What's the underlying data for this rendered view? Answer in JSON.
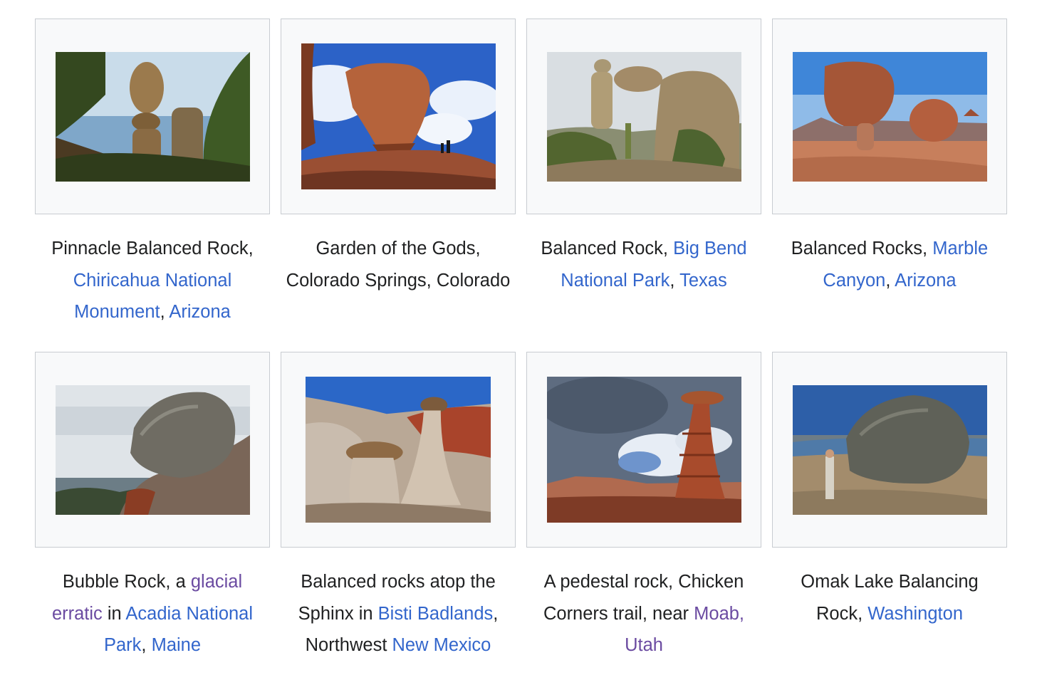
{
  "gallery": {
    "items": [
      {
        "name": "pinnacle-balanced-rock",
        "image": "photo-pinnacle-balanced-rock",
        "caption": [
          {
            "text": "Pinnacle Balanced Rock, ",
            "link": false
          },
          {
            "text": "Chiricahua National Monument",
            "link": true,
            "visited": false
          },
          {
            "text": ", ",
            "link": false
          },
          {
            "text": "Arizona",
            "link": true,
            "visited": false
          }
        ]
      },
      {
        "name": "garden-of-the-gods",
        "image": "photo-garden-of-the-gods",
        "caption": [
          {
            "text": "Garden of the Gods, Colorado Springs, Colorado",
            "link": false
          }
        ]
      },
      {
        "name": "balanced-rock-big-bend",
        "image": "photo-balanced-rock-big-bend",
        "caption": [
          {
            "text": "Balanced Rock, ",
            "link": false
          },
          {
            "text": "Big Bend National Park",
            "link": true,
            "visited": false
          },
          {
            "text": ", ",
            "link": false
          },
          {
            "text": "Texas",
            "link": true,
            "visited": false
          }
        ]
      },
      {
        "name": "balanced-rocks-marble-canyon",
        "image": "photo-balanced-rocks-marble-canyon",
        "caption": [
          {
            "text": "Balanced Rocks, ",
            "link": false
          },
          {
            "text": "Marble Canyon",
            "link": true,
            "visited": false
          },
          {
            "text": ", ",
            "link": false
          },
          {
            "text": "Arizona",
            "link": true,
            "visited": false
          }
        ]
      },
      {
        "name": "bubble-rock",
        "image": "photo-bubble-rock",
        "caption": [
          {
            "text": "Bubble Rock, a ",
            "link": false
          },
          {
            "text": "glacial erratic",
            "link": true,
            "visited": true
          },
          {
            "text": " in ",
            "link": false
          },
          {
            "text": "Acadia National Park",
            "link": true,
            "visited": false
          },
          {
            "text": ", ",
            "link": false
          },
          {
            "text": "Maine",
            "link": true,
            "visited": false
          }
        ]
      },
      {
        "name": "bisti-sphinx",
        "image": "photo-bisti-sphinx",
        "caption": [
          {
            "text": "Balanced rocks atop the Sphinx in ",
            "link": false
          },
          {
            "text": "Bisti Badlands",
            "link": true,
            "visited": false
          },
          {
            "text": ", Northwest ",
            "link": false
          },
          {
            "text": "New Mexico",
            "link": true,
            "visited": false
          }
        ]
      },
      {
        "name": "chicken-corners-pedestal",
        "image": "photo-chicken-corners-pedestal",
        "caption": [
          {
            "text": "A pedestal rock, Chicken Corners trail, near ",
            "link": false
          },
          {
            "text": "Moab, Utah",
            "link": true,
            "visited": true
          }
        ]
      },
      {
        "name": "omak-lake-balancing-rock",
        "image": "photo-omak-lake-balancing-rock",
        "caption": [
          {
            "text": "Omak Lake Balancing Rock, ",
            "link": false
          },
          {
            "text": "Washington",
            "link": true,
            "visited": false
          }
        ]
      }
    ]
  },
  "colors": {
    "link": "#3366cc",
    "visited_link": "#6b4ba1",
    "text": "#202122",
    "thumb_border": "#c8ccd1",
    "thumb_background": "#f8f9fa"
  }
}
